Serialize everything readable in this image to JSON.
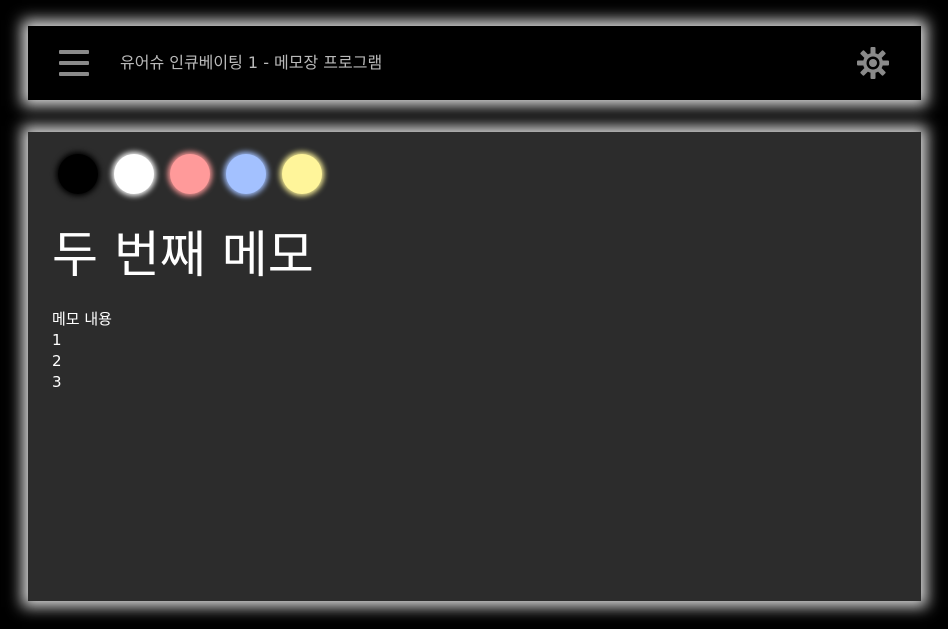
{
  "header": {
    "title": "유어슈 인큐베이팅 1 - 메모장 프로그램",
    "menu_icon": "hamburger-menu-icon",
    "settings_icon": "gear-icon",
    "icon_color": "#8a8a8a"
  },
  "palette": {
    "colors": [
      {
        "name": "black",
        "hex": "#000000"
      },
      {
        "name": "white",
        "hex": "#ffffff"
      },
      {
        "name": "pink",
        "hex": "#ff9a9a"
      },
      {
        "name": "blue",
        "hex": "#a3c1ff"
      },
      {
        "name": "yellow",
        "hex": "#fff59a"
      }
    ]
  },
  "memo": {
    "title": "두 번째 메모",
    "lines": [
      "메모 내용",
      "1",
      "2",
      "3"
    ]
  },
  "theme": {
    "background": "#000000",
    "content_background": "#2c2c2c",
    "text_color": "#ffffff"
  }
}
